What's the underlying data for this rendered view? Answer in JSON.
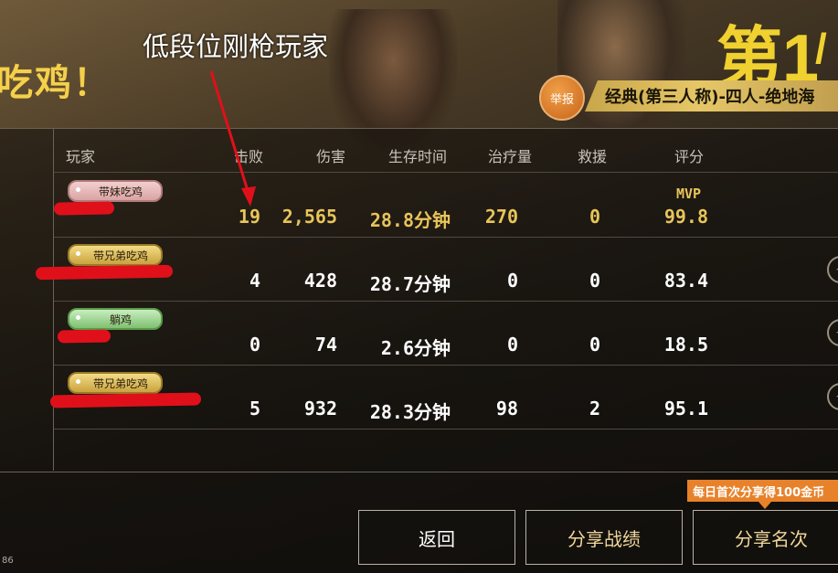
{
  "header": {
    "result_text": "吃鸡！",
    "rank_text": "第1",
    "rank_slash": "/",
    "report_label": "举报",
    "mode_text": "经典(第三人称)-四人-绝地海"
  },
  "annotation": {
    "text": "低段位刚枪玩家"
  },
  "table": {
    "columns": [
      "玩家",
      "击败",
      "伤害",
      "生存时间",
      "治疗量",
      "救援",
      "评分"
    ],
    "rows": [
      {
        "tag": "带妹吃鸡",
        "kills": "19",
        "damage": "2,565",
        "survival": "28.8分钟",
        "heal": "270",
        "rescue": "0",
        "badge": "MVP",
        "score": "99.8"
      },
      {
        "tag": "带兄弟吃鸡",
        "kills": "4",
        "damage": "428",
        "survival": "28.7分钟",
        "heal": "0",
        "rescue": "0",
        "badge": "",
        "score": "83.4"
      },
      {
        "tag": "躺鸡",
        "kills": "0",
        "damage": "74",
        "survival": "2.6分钟",
        "heal": "0",
        "rescue": "0",
        "badge": "",
        "score": "18.5"
      },
      {
        "tag": "带兄弟吃鸡",
        "kills": "5",
        "damage": "932",
        "survival": "28.3分钟",
        "heal": "98",
        "rescue": "2",
        "badge": "",
        "score": "95.1"
      }
    ]
  },
  "promo": {
    "text": "每日首次分享得100金币"
  },
  "buttons": {
    "back": "返回",
    "share_record": "分享战绩",
    "share_rank": "分享名次"
  },
  "corner": {
    "text": "86"
  },
  "colors": {
    "accent_gold": "#f0d12f",
    "mvp_gold": "#e8c45a",
    "redaction": "#e0101a",
    "promo_orange": "#e8822a"
  }
}
